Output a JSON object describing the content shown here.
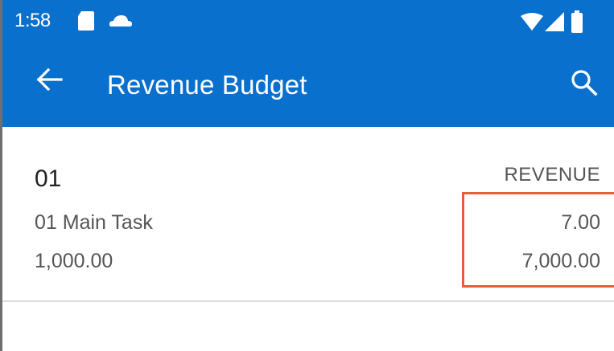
{
  "status_bar": {
    "time": "1:58",
    "icons": [
      "sd-card-icon",
      "cloud-icon",
      "wifi-icon",
      "signal-icon",
      "battery-icon"
    ]
  },
  "app_bar": {
    "title": "Revenue Budget",
    "back_icon": "arrow-back-icon",
    "search_icon": "search-icon",
    "background": "#0a70cd"
  },
  "list": {
    "items": [
      {
        "id": "01",
        "type": "REVENUE",
        "task": "01 Main Task",
        "quantity": "7.00",
        "amount": "1,000.00",
        "total": "7,000.00"
      }
    ]
  },
  "highlight": {
    "color": "#ef5a3c"
  }
}
